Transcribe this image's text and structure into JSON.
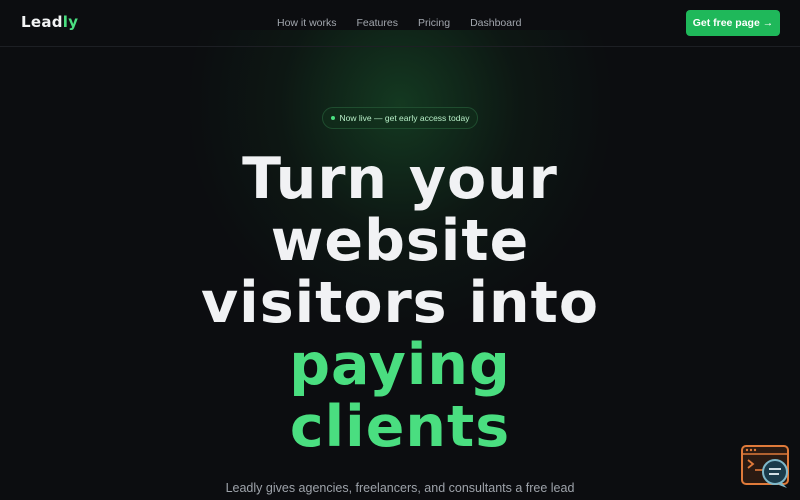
{
  "nav": {
    "logo_main": "Lead",
    "logo_accent": "ly",
    "links": [
      "How it works",
      "Features",
      "Pricing",
      "Dashboard"
    ],
    "cta_label": "Get free page",
    "cta_arrow": "→"
  },
  "hero": {
    "badge": "Now live — get early access today",
    "headline_lines": [
      "Turn your",
      "website",
      "visitors into"
    ],
    "headline_green_lines": [
      "paying",
      "clients"
    ],
    "subtext": "Leadly gives agencies, freelancers, and consultants a free lead"
  },
  "colors": {
    "accent": "#4ade80",
    "button": "#1fb85a",
    "background": "#0c0d10"
  },
  "icons": {
    "chat_widget": "chat-support-icon"
  }
}
